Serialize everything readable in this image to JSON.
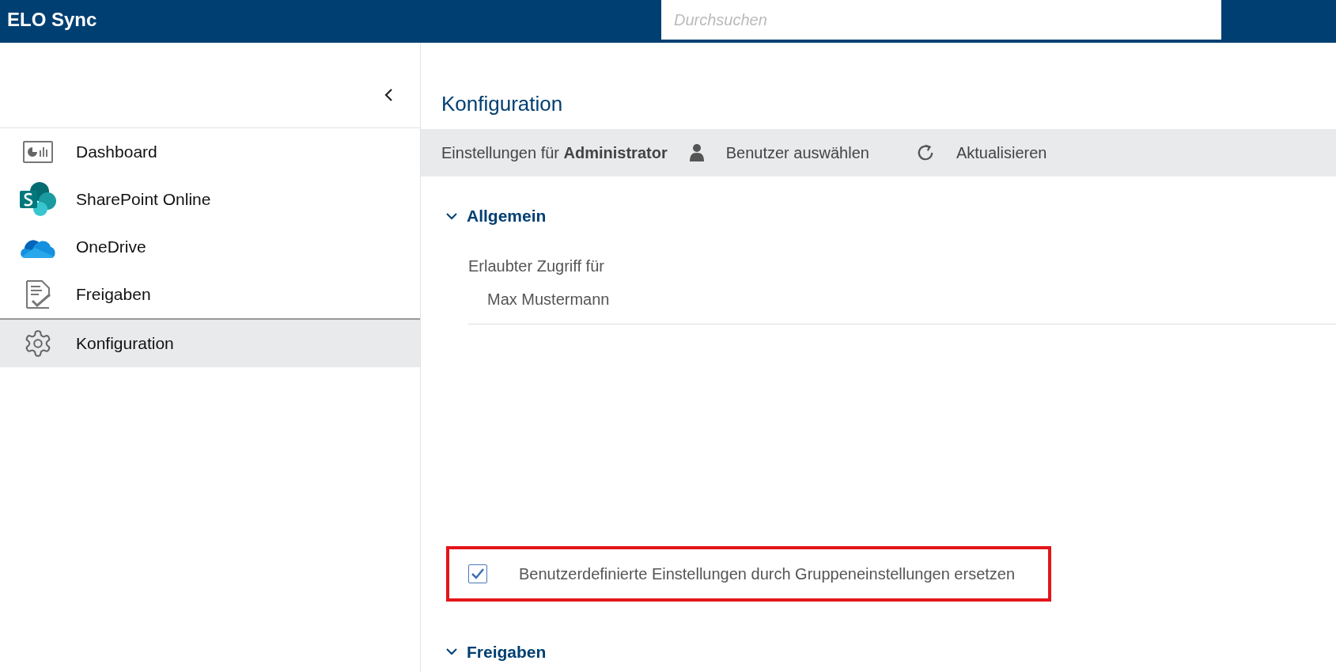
{
  "app_title": "ELO Sync",
  "search": {
    "placeholder": "Durchsuchen"
  },
  "sidebar": {
    "items": [
      {
        "label": "Dashboard",
        "kind": "dashboard",
        "selected": false
      },
      {
        "label": "SharePoint Online",
        "kind": "sharepoint",
        "selected": false
      },
      {
        "label": "OneDrive",
        "kind": "onedrive",
        "selected": false
      },
      {
        "label": "Freigaben",
        "kind": "approvals",
        "selected": false
      },
      {
        "label": "Konfiguration",
        "kind": "settings",
        "selected": true
      }
    ]
  },
  "page_title": "Konfiguration",
  "toolbar": {
    "settings_for": "Einstellungen für **Administrator**",
    "actions": [
      {
        "label": "Benutzer auswählen",
        "kind": "user"
      },
      {
        "label": "Aktualisieren",
        "kind": "refresh"
      }
    ]
  },
  "sections": [
    {
      "title": "Allgemein",
      "expanded": true,
      "field_label": "Erlaubter Zugriff für",
      "values": [
        "Max Mustermann"
      ],
      "checkbox": {
        "label": "Benutzerdefinierte Einstellungen durch Gruppeneinstellungen ersetzen",
        "checked": true,
        "highlighted": true
      }
    },
    {
      "title": "Freigaben",
      "expanded": true
    }
  ]
}
